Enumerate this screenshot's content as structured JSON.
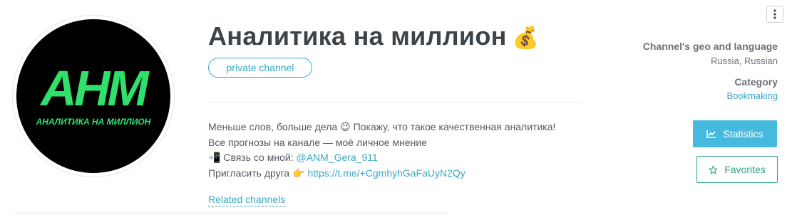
{
  "channel": {
    "title": "Аналитика на миллион",
    "title_emoji": "💰",
    "badge": "private channel",
    "avatar": {
      "logo_text": "AHM",
      "logo_subtext": "АНАЛИТИКА НА МИЛЛИОН",
      "logo_color": "#2fe06b",
      "background": "#000000"
    }
  },
  "description": {
    "line1_text": "Меньше слов, больше дела",
    "line1_emoji": "😉",
    "line1_rest": "Покажу, что такое качественная аналитика!",
    "line2": "Все прогнозы на канале — моё личное мнение",
    "line3_emoji": "📲",
    "line3_text": "Связь со мной:",
    "line3_link": "@ANM_Gera_911",
    "line4_text": "Пригласить друга",
    "line4_emoji": "👉",
    "line4_link": "https://t.me/+CgmhyhGaFaUyN2Qy"
  },
  "related_link": "Related channels",
  "sidebar": {
    "geo_label": "Channel's geo and language",
    "geo_value": "Russia, Russian",
    "category_label": "Category",
    "category_value": "Bookmaking"
  },
  "buttons": {
    "statistics": "Statistics",
    "favorites": "Favorites"
  },
  "icons": {
    "menu": "kebab-menu-icon",
    "statistics": "chart-line-icon",
    "favorites": "star-outline-icon"
  },
  "colors": {
    "accent": "#3aa8c8",
    "stats_button": "#46bade",
    "favorites_button": "#2da57c"
  }
}
